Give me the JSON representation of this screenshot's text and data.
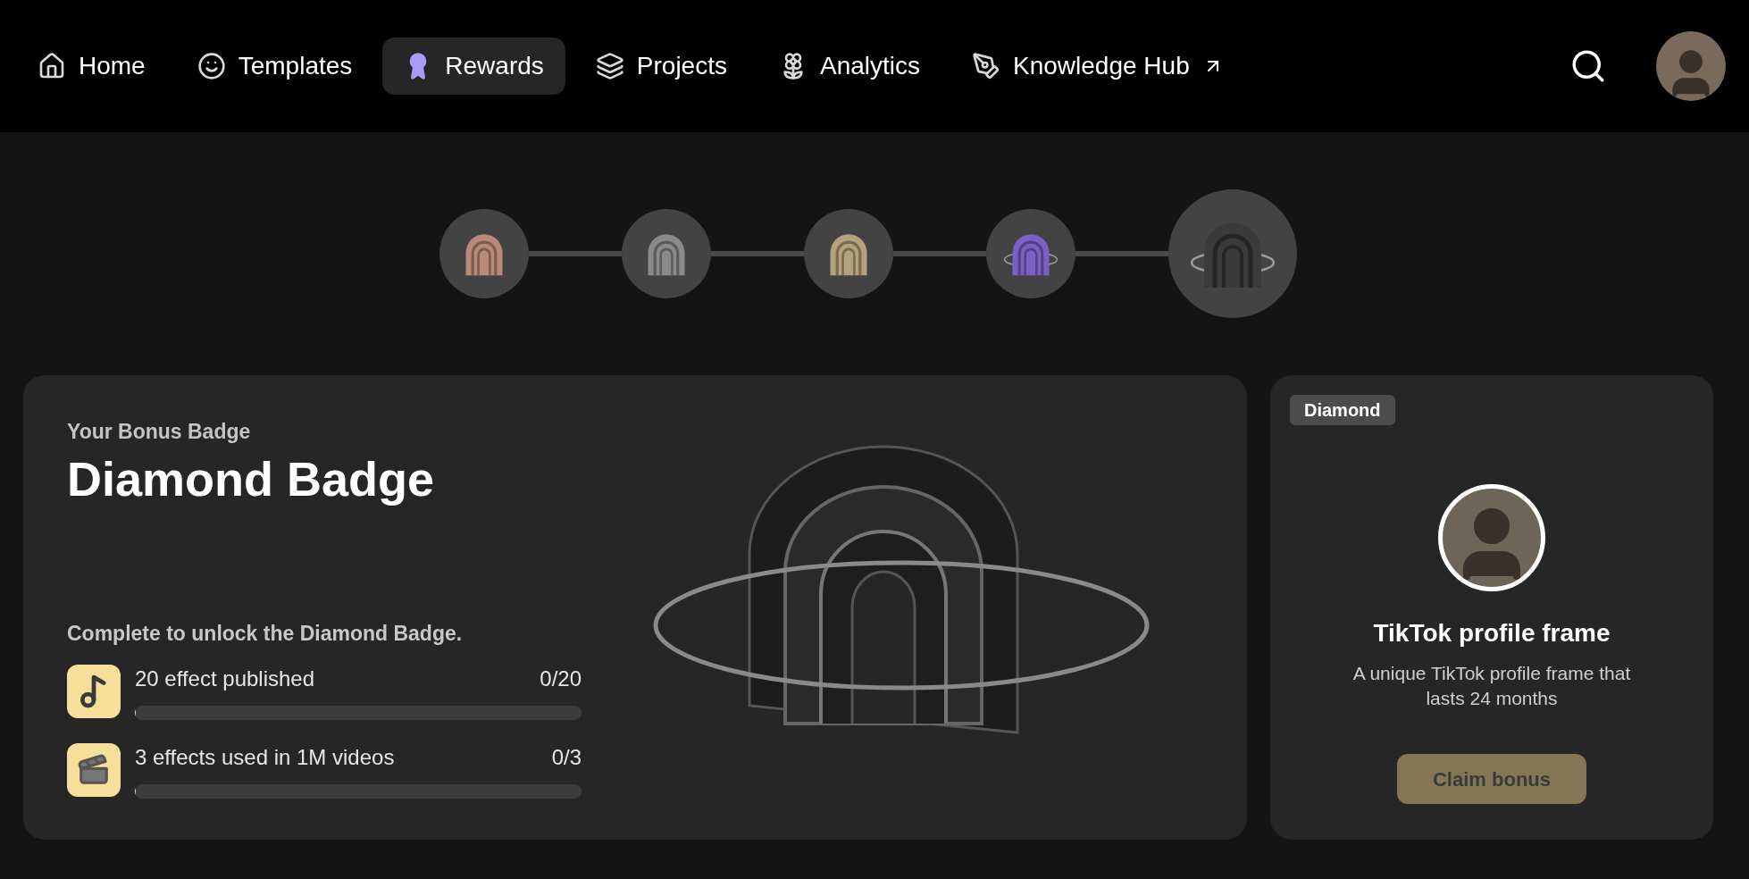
{
  "nav": {
    "items": [
      {
        "label": "Home",
        "kind": "home",
        "selected": false
      },
      {
        "label": "Templates",
        "kind": "templates",
        "selected": false
      },
      {
        "label": "Rewards",
        "kind": "rewards",
        "selected": true
      },
      {
        "label": "Projects",
        "kind": "projects",
        "selected": false
      },
      {
        "label": "Analytics",
        "kind": "analytics",
        "selected": false
      },
      {
        "label": "Knowledge Hub",
        "kind": "external",
        "selected": false
      }
    ]
  },
  "badge_steps": [
    {
      "color": "#b98a78",
      "selected": false
    },
    {
      "color": "#8a8a8a",
      "selected": false
    },
    {
      "color": "#b3a27c",
      "selected": false
    },
    {
      "color": "#7a62c4",
      "selected": false
    },
    {
      "color": "#3a3a3a",
      "selected": true
    }
  ],
  "badge_card": {
    "eyebrow": "Your Bonus Badge",
    "title": "Diamond Badge",
    "instruction": "Complete to unlock the Diamond Badge.",
    "tasks": [
      {
        "kind": "music",
        "label": "20 effect published",
        "reading": "0/20",
        "level": 0
      },
      {
        "kind": "video",
        "label": "3 effects used in 1M videos",
        "reading": "0/3",
        "level": 0
      }
    ]
  },
  "reward_card": {
    "tag": "Diamond",
    "title": "TikTok profile frame",
    "description": "A unique TikTok profile frame that lasts 24 months",
    "button": {
      "label": "Claim bonus",
      "disabled": true
    }
  }
}
